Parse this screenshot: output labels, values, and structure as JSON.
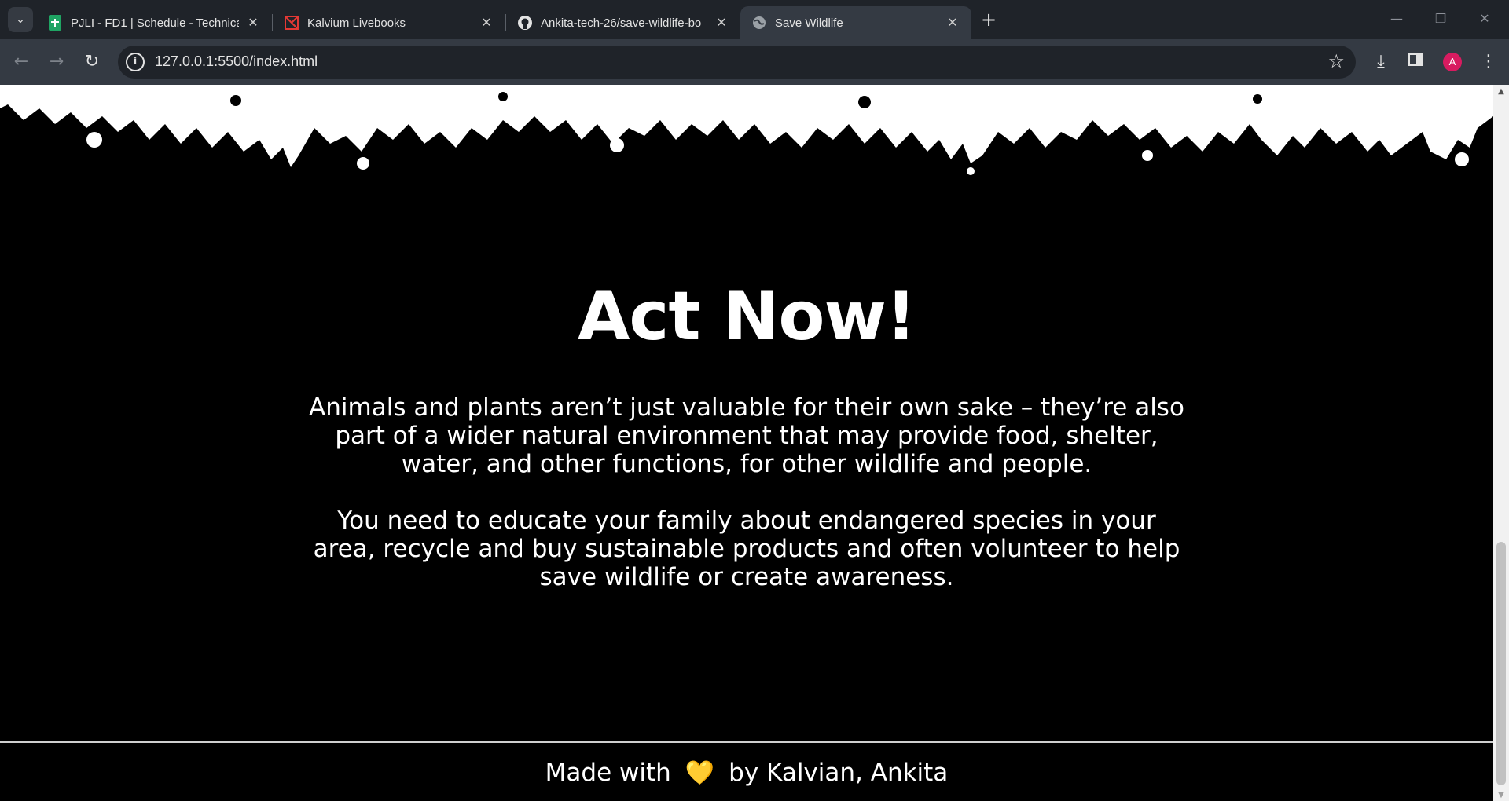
{
  "browser": {
    "tabs": [
      {
        "title": "PJLI - FD1 | Schedule - Technica",
        "favicon": "google-sheets-icon",
        "active": false
      },
      {
        "title": "Kalvium Livebooks",
        "favicon": "kalvium-icon",
        "active": false
      },
      {
        "title": "Ankita-tech-26/save-wildlife-bo",
        "favicon": "github-icon",
        "active": false
      },
      {
        "title": "Save Wildlife",
        "favicon": "globe-icon",
        "active": true
      }
    ],
    "url": "127.0.0.1:5500/index.html",
    "profile_initial": "A",
    "colors": {
      "tabstrip": "#1f2329",
      "toolbar": "#343a43",
      "avatar": "#d81b60"
    }
  },
  "page": {
    "headline": "Act Now!",
    "paragraph_1": "Animals and plants aren’t just valuable for their own sake – they’re also part of a wider natural environment that may provide food, shelter, water, and other functions, for other wildlife and people.",
    "paragraph_2": "You need to educate your family about endangered species in your area, recycle and buy sustainable products and often volunteer to help save wildlife or create awareness.",
    "footer": {
      "prefix": "Made with",
      "heart": "💛",
      "suffix": "by Kalvian, Ankita"
    },
    "colors": {
      "background": "#000000",
      "text": "#ffffff",
      "heart": "#f5c518"
    }
  }
}
